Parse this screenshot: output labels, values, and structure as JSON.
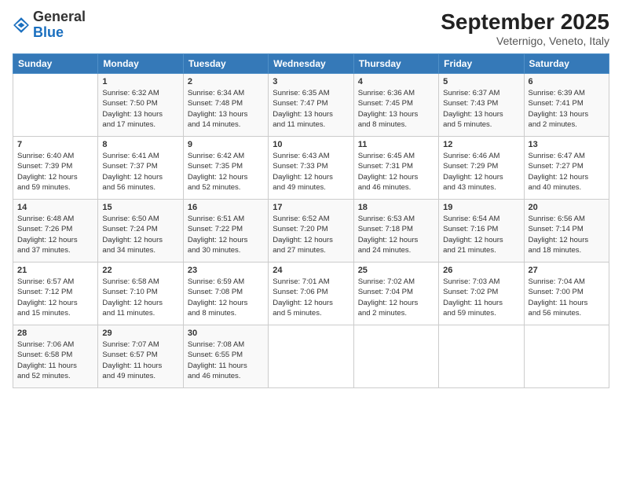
{
  "header": {
    "logo_general": "General",
    "logo_blue": "Blue",
    "month_title": "September 2025",
    "location": "Veternigo, Veneto, Italy"
  },
  "days_of_week": [
    "Sunday",
    "Monday",
    "Tuesday",
    "Wednesday",
    "Thursday",
    "Friday",
    "Saturday"
  ],
  "weeks": [
    [
      {
        "day": "",
        "info": ""
      },
      {
        "day": "1",
        "info": "Sunrise: 6:32 AM\nSunset: 7:50 PM\nDaylight: 13 hours\nand 17 minutes."
      },
      {
        "day": "2",
        "info": "Sunrise: 6:34 AM\nSunset: 7:48 PM\nDaylight: 13 hours\nand 14 minutes."
      },
      {
        "day": "3",
        "info": "Sunrise: 6:35 AM\nSunset: 7:47 PM\nDaylight: 13 hours\nand 11 minutes."
      },
      {
        "day": "4",
        "info": "Sunrise: 6:36 AM\nSunset: 7:45 PM\nDaylight: 13 hours\nand 8 minutes."
      },
      {
        "day": "5",
        "info": "Sunrise: 6:37 AM\nSunset: 7:43 PM\nDaylight: 13 hours\nand 5 minutes."
      },
      {
        "day": "6",
        "info": "Sunrise: 6:39 AM\nSunset: 7:41 PM\nDaylight: 13 hours\nand 2 minutes."
      }
    ],
    [
      {
        "day": "7",
        "info": "Sunrise: 6:40 AM\nSunset: 7:39 PM\nDaylight: 12 hours\nand 59 minutes."
      },
      {
        "day": "8",
        "info": "Sunrise: 6:41 AM\nSunset: 7:37 PM\nDaylight: 12 hours\nand 56 minutes."
      },
      {
        "day": "9",
        "info": "Sunrise: 6:42 AM\nSunset: 7:35 PM\nDaylight: 12 hours\nand 52 minutes."
      },
      {
        "day": "10",
        "info": "Sunrise: 6:43 AM\nSunset: 7:33 PM\nDaylight: 12 hours\nand 49 minutes."
      },
      {
        "day": "11",
        "info": "Sunrise: 6:45 AM\nSunset: 7:31 PM\nDaylight: 12 hours\nand 46 minutes."
      },
      {
        "day": "12",
        "info": "Sunrise: 6:46 AM\nSunset: 7:29 PM\nDaylight: 12 hours\nand 43 minutes."
      },
      {
        "day": "13",
        "info": "Sunrise: 6:47 AM\nSunset: 7:27 PM\nDaylight: 12 hours\nand 40 minutes."
      }
    ],
    [
      {
        "day": "14",
        "info": "Sunrise: 6:48 AM\nSunset: 7:26 PM\nDaylight: 12 hours\nand 37 minutes."
      },
      {
        "day": "15",
        "info": "Sunrise: 6:50 AM\nSunset: 7:24 PM\nDaylight: 12 hours\nand 34 minutes."
      },
      {
        "day": "16",
        "info": "Sunrise: 6:51 AM\nSunset: 7:22 PM\nDaylight: 12 hours\nand 30 minutes."
      },
      {
        "day": "17",
        "info": "Sunrise: 6:52 AM\nSunset: 7:20 PM\nDaylight: 12 hours\nand 27 minutes."
      },
      {
        "day": "18",
        "info": "Sunrise: 6:53 AM\nSunset: 7:18 PM\nDaylight: 12 hours\nand 24 minutes."
      },
      {
        "day": "19",
        "info": "Sunrise: 6:54 AM\nSunset: 7:16 PM\nDaylight: 12 hours\nand 21 minutes."
      },
      {
        "day": "20",
        "info": "Sunrise: 6:56 AM\nSunset: 7:14 PM\nDaylight: 12 hours\nand 18 minutes."
      }
    ],
    [
      {
        "day": "21",
        "info": "Sunrise: 6:57 AM\nSunset: 7:12 PM\nDaylight: 12 hours\nand 15 minutes."
      },
      {
        "day": "22",
        "info": "Sunrise: 6:58 AM\nSunset: 7:10 PM\nDaylight: 12 hours\nand 11 minutes."
      },
      {
        "day": "23",
        "info": "Sunrise: 6:59 AM\nSunset: 7:08 PM\nDaylight: 12 hours\nand 8 minutes."
      },
      {
        "day": "24",
        "info": "Sunrise: 7:01 AM\nSunset: 7:06 PM\nDaylight: 12 hours\nand 5 minutes."
      },
      {
        "day": "25",
        "info": "Sunrise: 7:02 AM\nSunset: 7:04 PM\nDaylight: 12 hours\nand 2 minutes."
      },
      {
        "day": "26",
        "info": "Sunrise: 7:03 AM\nSunset: 7:02 PM\nDaylight: 11 hours\nand 59 minutes."
      },
      {
        "day": "27",
        "info": "Sunrise: 7:04 AM\nSunset: 7:00 PM\nDaylight: 11 hours\nand 56 minutes."
      }
    ],
    [
      {
        "day": "28",
        "info": "Sunrise: 7:06 AM\nSunset: 6:58 PM\nDaylight: 11 hours\nand 52 minutes."
      },
      {
        "day": "29",
        "info": "Sunrise: 7:07 AM\nSunset: 6:57 PM\nDaylight: 11 hours\nand 49 minutes."
      },
      {
        "day": "30",
        "info": "Sunrise: 7:08 AM\nSunset: 6:55 PM\nDaylight: 11 hours\nand 46 minutes."
      },
      {
        "day": "",
        "info": ""
      },
      {
        "day": "",
        "info": ""
      },
      {
        "day": "",
        "info": ""
      },
      {
        "day": "",
        "info": ""
      }
    ]
  ]
}
